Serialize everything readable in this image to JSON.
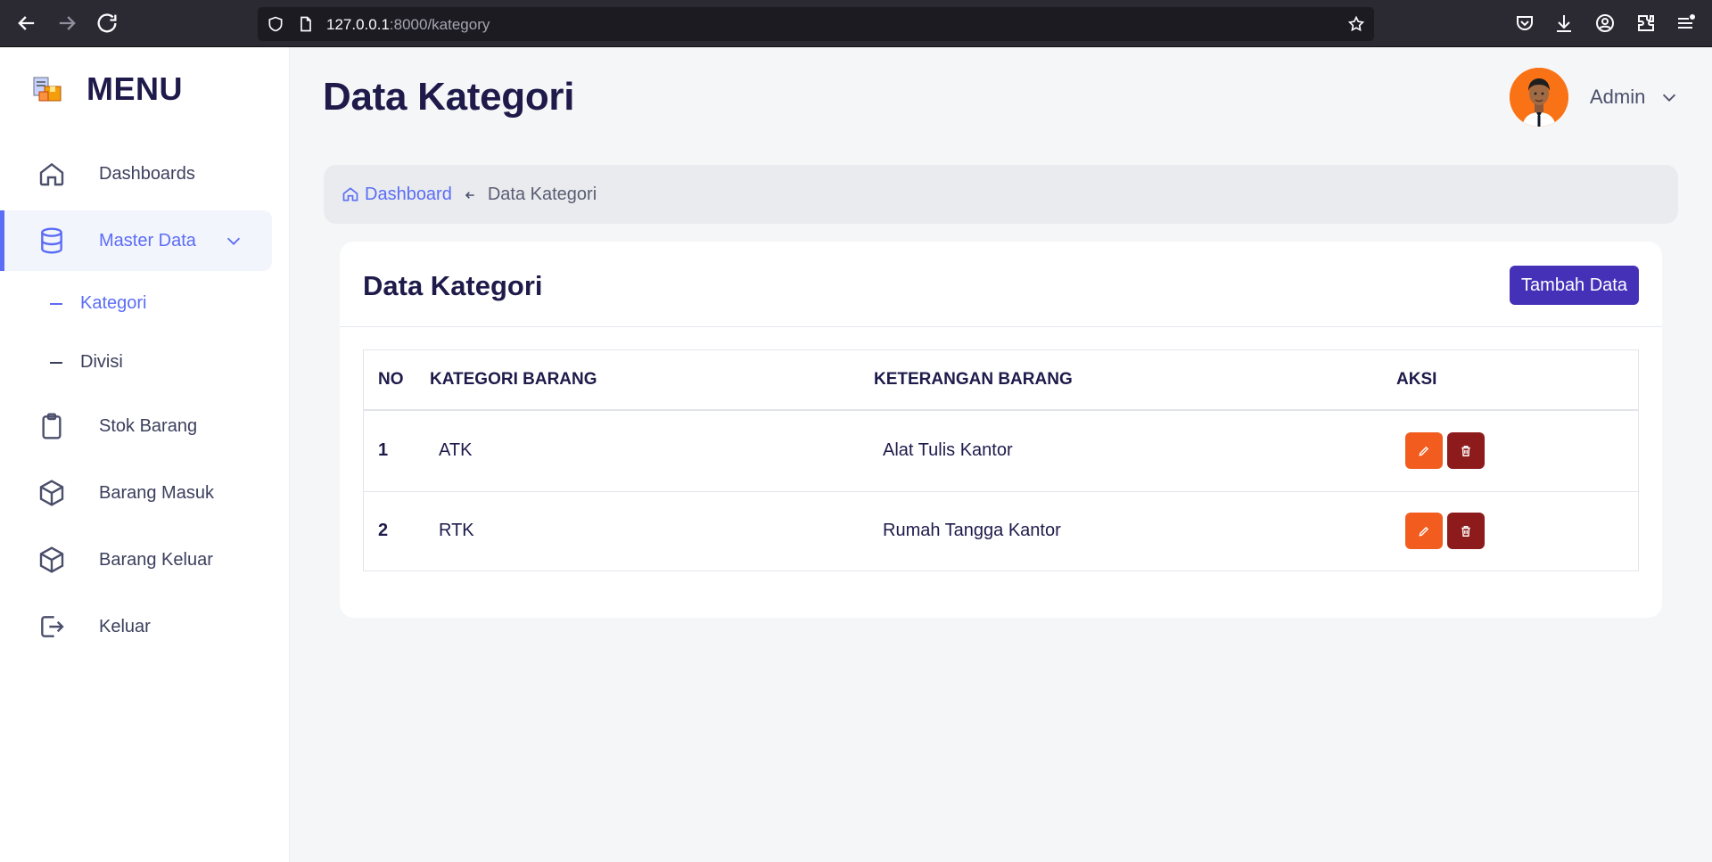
{
  "browser": {
    "url_host": "127.0.0.1",
    "url_rest": ":8000/kategory"
  },
  "sidebar": {
    "brand": "MENU",
    "items": [
      {
        "label": "Dashboards",
        "icon": "home-icon"
      },
      {
        "label": "Master Data",
        "icon": "database-icon",
        "active": true
      },
      {
        "label": "Stok Barang",
        "icon": "clipboard-icon"
      },
      {
        "label": "Barang Masuk",
        "icon": "box-icon"
      },
      {
        "label": "Barang Keluar",
        "icon": "box-icon"
      },
      {
        "label": "Keluar",
        "icon": "logout-icon"
      }
    ],
    "sub_items": [
      {
        "label": "Kategori",
        "active": true
      },
      {
        "label": "Divisi",
        "active": false
      }
    ]
  },
  "header": {
    "title": "Data Kategori",
    "user_name": "Admin"
  },
  "breadcrumb": {
    "home": "Dashboard",
    "current": "Data Kategori"
  },
  "card": {
    "title": "Data Kategori",
    "add_button": "Tambah Data"
  },
  "table": {
    "columns": [
      "NO",
      "KATEGORI BARANG",
      "KETERANGAN BARANG",
      "AKSI"
    ],
    "rows": [
      {
        "no": "1",
        "kategori": "ATK",
        "keterangan": "Alat Tulis Kantor"
      },
      {
        "no": "2",
        "kategori": "RTK",
        "keterangan": "Rumah Tangga Kantor"
      }
    ]
  },
  "colors": {
    "accent": "#5b6df5",
    "primary_button": "#4530b8",
    "edit_button": "#f25c1f",
    "delete_button": "#8e1b1b"
  }
}
